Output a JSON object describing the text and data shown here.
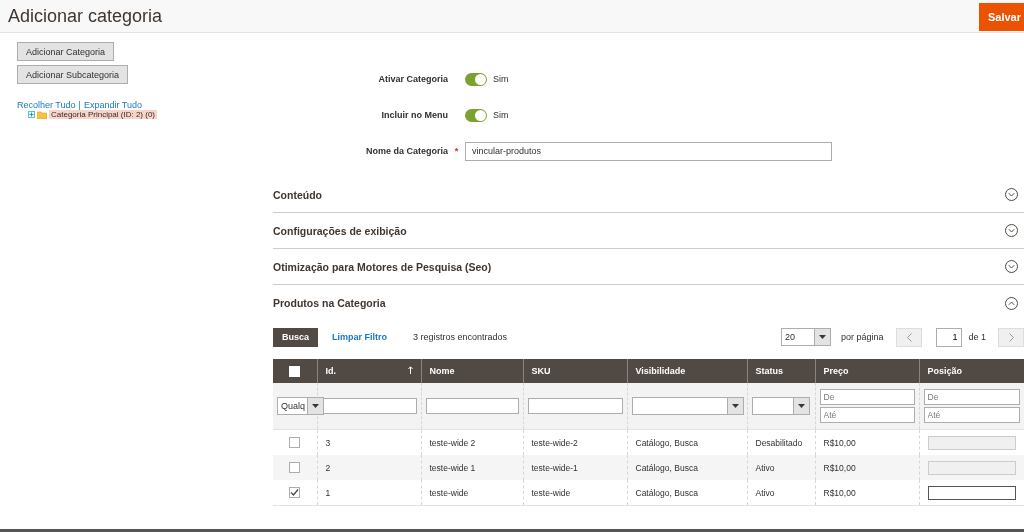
{
  "page": {
    "title": "Adicionar categoria",
    "save_button": "Salvar"
  },
  "sidebar": {
    "buttons": [
      "Adicionar Categoria",
      "Adicionar Subcategoria"
    ],
    "collapse_all": "Recolher Tudo",
    "separator": "|",
    "expand_all": "Expandir Tudo",
    "tree": [
      {
        "label": "Categoria Principal (ID: 2) (0)",
        "selected": true,
        "expanded": false
      }
    ]
  },
  "form": {
    "fields": [
      {
        "kind": "toggle",
        "label": "Ativar Categoria",
        "on": true,
        "value": "Sim"
      },
      {
        "kind": "toggle",
        "label": "Incluir no Menu",
        "on": true,
        "value": "Sim"
      },
      {
        "kind": "text",
        "label": "Nome da Categoria",
        "required_mark": "*",
        "value": "vincular-produtos"
      }
    ]
  },
  "sections": [
    {
      "title": "Conteúdo",
      "expanded": false
    },
    {
      "title": "Configurações de exibição",
      "expanded": false
    },
    {
      "title": "Otimização para Motores de Pesquisa (Seo)",
      "expanded": false
    },
    {
      "title": "Produtos na Categoria",
      "expanded": true
    }
  ],
  "grid": {
    "search_button": "Busca",
    "reset_filter": "Limpar Filtro",
    "records": "3 registros encontrados",
    "per_page": "20",
    "per_page_label": "por página",
    "page": "1",
    "page_total": "de 1",
    "select_all_checked": false,
    "columns": [
      {
        "label": "Id.",
        "sorted": true
      },
      {
        "label": "Nome",
        "sorted": false
      },
      {
        "label": "SKU",
        "sorted": false
      },
      {
        "label": "Visibilidade",
        "sorted": false
      },
      {
        "label": "Status",
        "sorted": false
      },
      {
        "label": "Preço",
        "sorted": false
      },
      {
        "label": "Posição",
        "sorted": false
      }
    ],
    "filters": {
      "in_category": "Qualq",
      "price_from": {
        "placeholder": "De"
      },
      "price_to": {
        "placeholder": "Até"
      },
      "position_from": {
        "placeholder": "De"
      },
      "position_to": {
        "placeholder": "Até"
      }
    },
    "rows": [
      {
        "checked": false,
        "id": "3",
        "name": "teste-wide 2",
        "sku": "teste-wide-2",
        "visibility": "Catálogo, Busca",
        "status": "Desabilitado",
        "price": "R$10,00",
        "position_disabled": true
      },
      {
        "checked": false,
        "id": "2",
        "name": "teste-wide 1",
        "sku": "teste-wide-1",
        "visibility": "Catálogo, Busca",
        "status": "Ativo",
        "price": "R$10,00",
        "position_disabled": true
      },
      {
        "checked": true,
        "id": "1",
        "name": "teste-wide",
        "sku": "teste-wide",
        "visibility": "Catálogo, Busca",
        "status": "Ativo",
        "price": "R$10,00",
        "position_disabled": false
      }
    ]
  }
}
